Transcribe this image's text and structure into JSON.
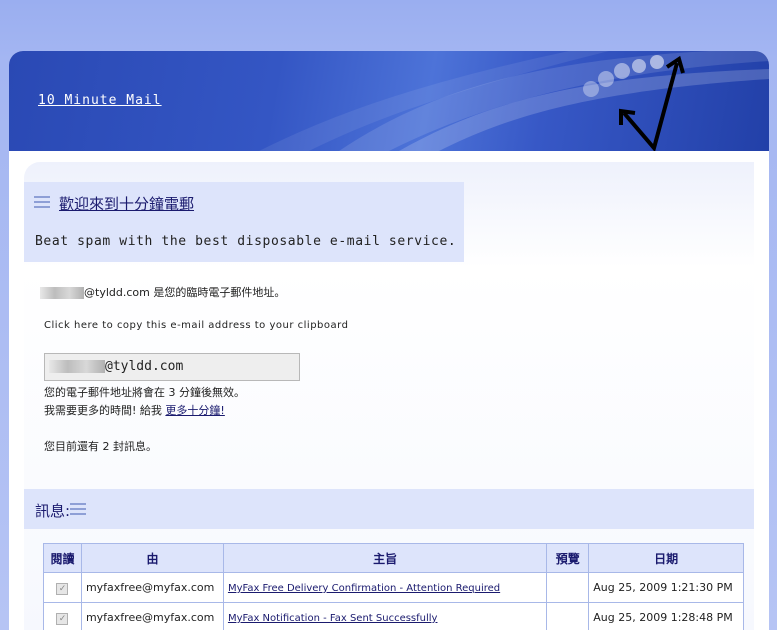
{
  "header": {
    "site_title": "10 Minute Mail"
  },
  "welcome": {
    "title": "歡迎來到十分鐘電郵",
    "subtitle": "Beat spam with the best disposable e-mail service."
  },
  "address": {
    "domain_suffix": "@tyldd.com",
    "description": "是您的臨時電子郵件地址。",
    "copy_link": "Click here to copy this e-mail address to your clipboard",
    "input_value_suffix": "@tyldd.com"
  },
  "expiry": {
    "text": "您的電子郵件地址將會在 3 分鐘後無效。",
    "more_prefix": "我需要更多的時間! 給我",
    "more_link": "更多十分鐘!"
  },
  "inbox": {
    "count_text": "您目前還有 2 封訊息。",
    "section_title": "訊息:",
    "columns": [
      "閱讀",
      "由",
      "主旨",
      "預覽",
      "日期"
    ],
    "rows": [
      {
        "from": "myfaxfree@myfax.com",
        "subject": "MyFax Free Delivery Confirmation - Attention Required",
        "preview": "",
        "date": "Aug 25, 2009 1:21:30 PM"
      },
      {
        "from": "myfaxfree@myfax.com",
        "subject": "MyFax Notification - Fax Sent Successfully",
        "preview": "",
        "date": "Aug 25, 2009 1:28:48 PM"
      }
    ]
  },
  "colors": {
    "header_blue": "#2a49b4",
    "panel_blue": "#dde4fb",
    "page_bg": "#9aaef0"
  }
}
